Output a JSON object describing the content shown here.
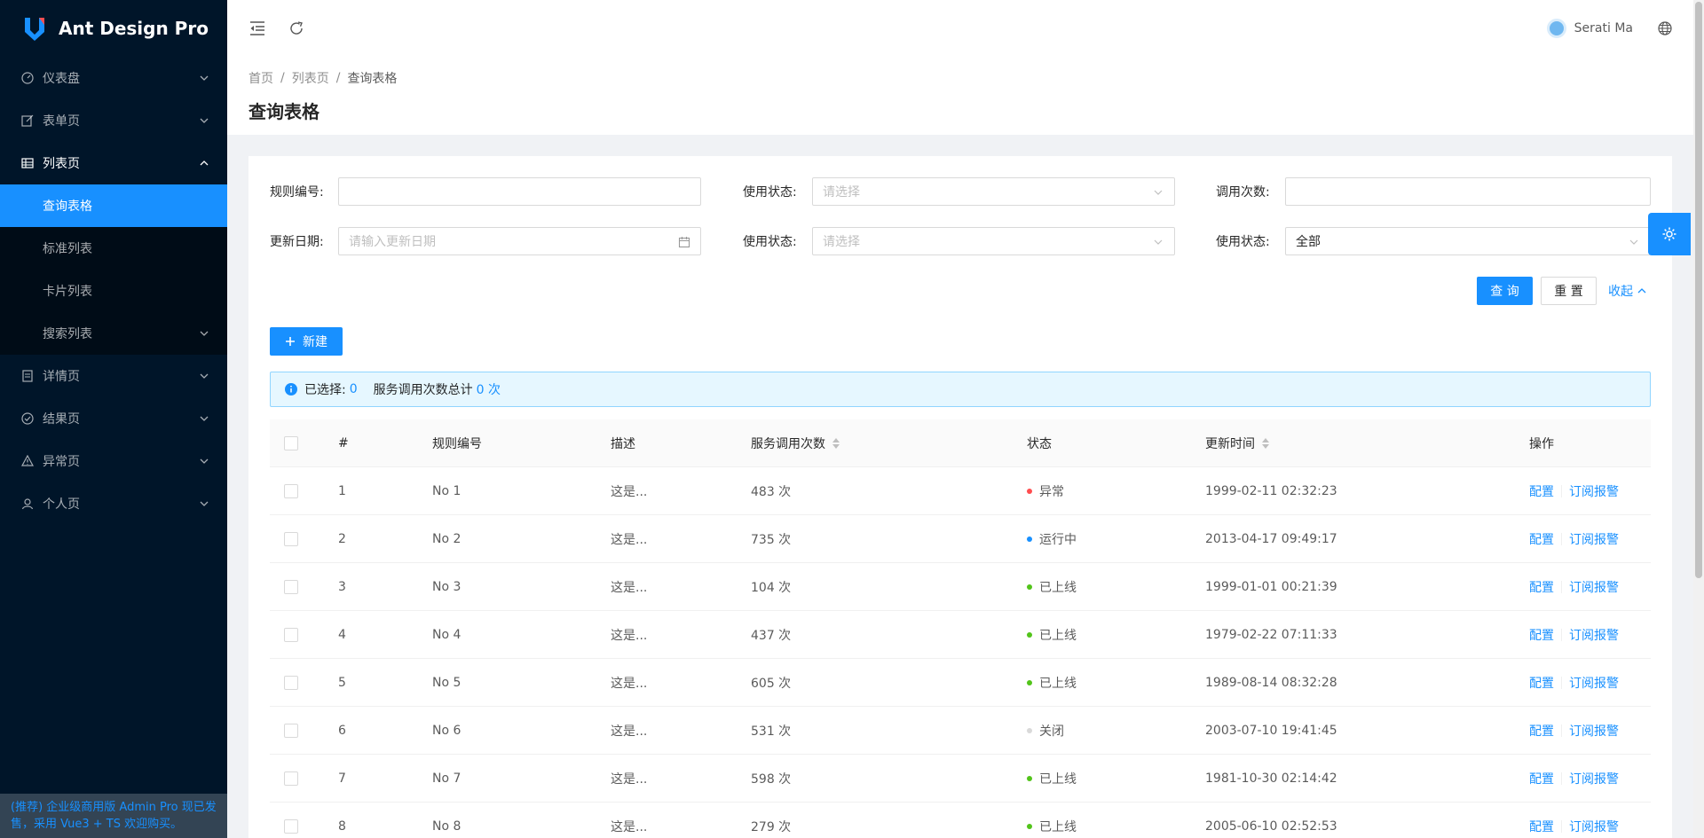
{
  "app": {
    "title": "Ant Design Pro"
  },
  "sidebar": {
    "items": [
      {
        "label": "仪表盘",
        "icon": "dashboard-icon"
      },
      {
        "label": "表单页",
        "icon": "form-icon"
      },
      {
        "label": "列表页",
        "icon": "table-icon",
        "open": true,
        "children": [
          {
            "label": "查询表格",
            "active": true
          },
          {
            "label": "标准列表"
          },
          {
            "label": "卡片列表"
          },
          {
            "label": "搜索列表"
          }
        ]
      },
      {
        "label": "详情页",
        "icon": "profile-icon"
      },
      {
        "label": "结果页",
        "icon": "check-circle-icon"
      },
      {
        "label": "异常页",
        "icon": "warning-icon"
      },
      {
        "label": "个人页",
        "icon": "user-icon"
      }
    ],
    "footer": "(推荐) 企业级商用版 Admin Pro 现已发售，采用 Vue3 + TS 欢迎购买。"
  },
  "header": {
    "username": "Serati Ma"
  },
  "breadcrumb": [
    "首页",
    "列表页",
    "查询表格"
  ],
  "page_title": "查询表格",
  "filters": {
    "rule_no_label": "规则编号:",
    "status1_label": "使用状态:",
    "status1_placeholder": "请选择",
    "call_count_label": "调用次数:",
    "date_label": "更新日期:",
    "date_placeholder": "请输入更新日期",
    "status2_label": "使用状态:",
    "status2_placeholder": "请选择",
    "status3_label": "使用状态:",
    "status3_value": "全部",
    "query_label": "查 询",
    "reset_label": "重 置",
    "collapse_label": "收起"
  },
  "new_button": "新建",
  "alert": {
    "selected_label": "已选择:",
    "selected_count": "0",
    "total_label": "服务调用次数总计",
    "total_value": "0 次"
  },
  "table": {
    "columns": [
      "#",
      "规则编号",
      "描述",
      "服务调用次数",
      "状态",
      "更新时间",
      "操作"
    ],
    "actions": [
      "配置",
      "订阅报警"
    ],
    "status_colors": {
      "异常": "#ff4d4f",
      "运行中": "#1890ff",
      "已上线": "#52c41a",
      "关闭": "#d9d9d9"
    },
    "rows": [
      {
        "idx": "1",
        "no": "No 1",
        "desc": "这是...",
        "calls": "483 次",
        "status": "异常",
        "updated": "1999-02-11 02:32:23"
      },
      {
        "idx": "2",
        "no": "No 2",
        "desc": "这是...",
        "calls": "735 次",
        "status": "运行中",
        "updated": "2013-04-17 09:49:17"
      },
      {
        "idx": "3",
        "no": "No 3",
        "desc": "这是...",
        "calls": "104 次",
        "status": "已上线",
        "updated": "1999-01-01 00:21:39"
      },
      {
        "idx": "4",
        "no": "No 4",
        "desc": "这是...",
        "calls": "437 次",
        "status": "已上线",
        "updated": "1979-02-22 07:11:33"
      },
      {
        "idx": "5",
        "no": "No 5",
        "desc": "这是...",
        "calls": "605 次",
        "status": "已上线",
        "updated": "1989-08-14 08:32:28"
      },
      {
        "idx": "6",
        "no": "No 6",
        "desc": "这是...",
        "calls": "531 次",
        "status": "关闭",
        "updated": "2003-07-10 19:41:45"
      },
      {
        "idx": "7",
        "no": "No 7",
        "desc": "这是...",
        "calls": "598 次",
        "status": "已上线",
        "updated": "1981-10-30 02:14:42"
      },
      {
        "idx": "8",
        "no": "No 8",
        "desc": "这是...",
        "calls": "279 次",
        "status": "已上线",
        "updated": "2005-06-10 02:52:53"
      }
    ]
  },
  "colors": {
    "primary": "#1890ff",
    "sider": "#001529",
    "sider_sub": "#000c17"
  }
}
